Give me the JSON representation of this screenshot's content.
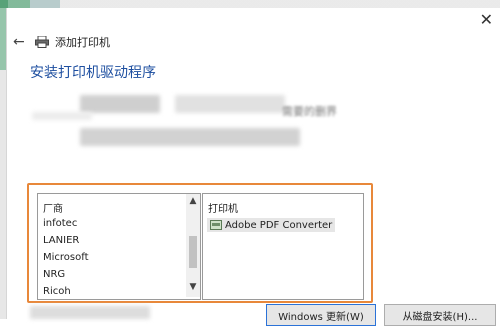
{
  "window": {
    "title": "添加打印机",
    "close_glyph": "✕",
    "back_glyph": "←"
  },
  "heading": "安装打印机驱动程序",
  "faint_text": "需要的删界",
  "manufacturers": {
    "header": "厂商",
    "items": [
      "infotec",
      "LANIER",
      "Microsoft",
      "NRG",
      "Ricoh"
    ]
  },
  "printers": {
    "header": "打印机",
    "items": [
      "Adobe PDF Converter"
    ]
  },
  "buttons": {
    "windows_update": "Windows 更新(W)",
    "have_disk": "从磁盘安装(H)..."
  },
  "colors": {
    "heading": "#1e4fa0",
    "highlight_frame": "#e8883a",
    "selection": "#e6e6e6"
  },
  "icons": {
    "back": "back-arrow-icon",
    "printer": "printer-icon",
    "close": "close-icon",
    "scroll_up": "chevron-up-icon",
    "scroll_down": "chevron-down-icon"
  }
}
